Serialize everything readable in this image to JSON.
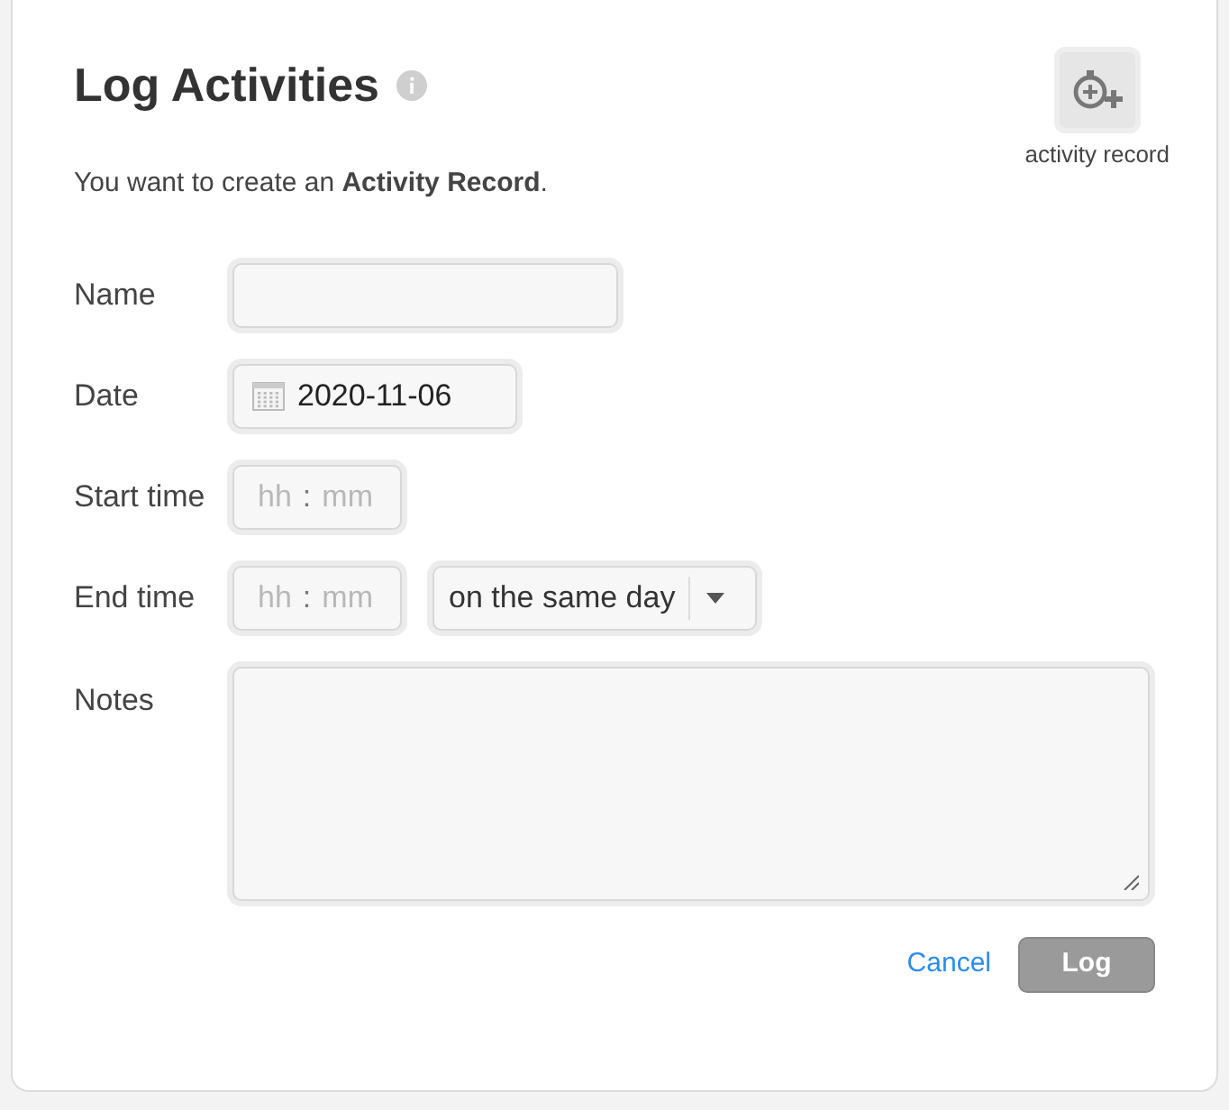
{
  "title": "Log Activities",
  "intro": "You want to create an **Activity Record**.",
  "record_button": {
    "label": "activity record"
  },
  "fields": [
    {
      "kind": "text",
      "label": "Name"
    },
    {
      "kind": "date",
      "label": "Date",
      "value": "2020-11-06"
    },
    {
      "kind": "time",
      "label": "Start time",
      "hour_placeholder": "hh",
      "separator": ":",
      "minute_placeholder": "mm"
    },
    {
      "kind": "time",
      "label": "End time",
      "hour_placeholder": "hh",
      "separator": ":",
      "minute_placeholder": "mm",
      "day_select": "on the same day"
    },
    {
      "kind": "textarea",
      "label": "Notes"
    }
  ],
  "actions": {
    "cancel": "Cancel",
    "submit": {
      "label": "Log",
      "disabled": true
    }
  }
}
